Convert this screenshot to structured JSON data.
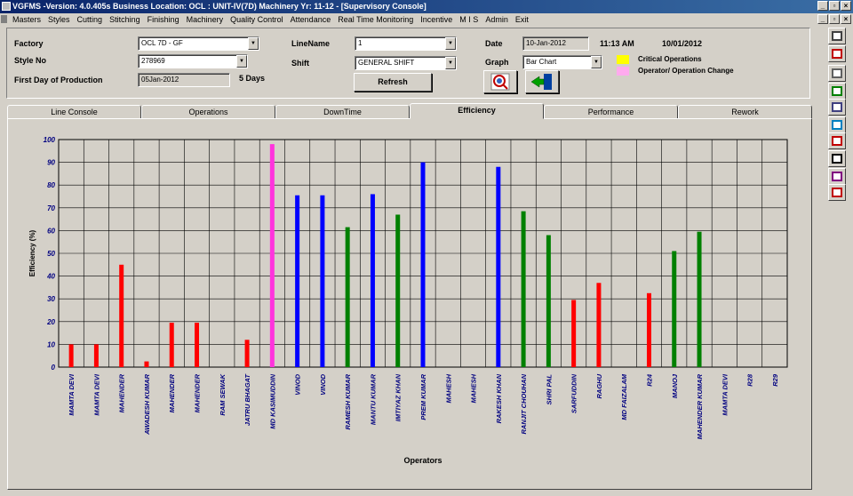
{
  "window": {
    "title": "VGFMS -Version: 4.0.405s Business Location: OCL : UNIT-IV(7D)  Machinery Yr: 11-12  - [Supervisory Console]"
  },
  "menu": [
    "Masters",
    "Styles",
    "Cutting",
    "Stitching",
    "Finishing",
    "Machinery",
    "Quality Control",
    "Attendance",
    "Real Time Monitoring",
    "Incentive",
    "M I S",
    "Admin",
    "Exit"
  ],
  "form": {
    "factory_label": "Factory",
    "factory_value": "OCL 7D - GF",
    "style_label": "Style No",
    "style_value": "278969",
    "first_day_label": "First Day of Production",
    "first_day_value": "05Jan-2012",
    "days_text": "5 Days",
    "line_label": "LineName",
    "line_value": "1",
    "shift_label": "Shift",
    "shift_value": "GENERAL SHIFT",
    "refresh_label": "Refresh",
    "date_label": "Date",
    "date_value": "10-Jan-2012",
    "time_text": "11:13 AM",
    "date_text": "10/01/2012",
    "graph_label": "Graph",
    "graph_value": "Bar Chart",
    "legend_critical": "Critical Operations",
    "legend_change": "Operator/ Operation Change",
    "critical_color": "#ffff00",
    "change_color": "#ffaaee"
  },
  "tabs": [
    "Line Console",
    "Operations",
    "DownTime",
    "Efficiency",
    "Performance",
    "Rework"
  ],
  "active_tab": "Efficiency",
  "toolbar_icons": [
    "print-icon",
    "print-preview-icon",
    "export-icon",
    "word-icon",
    "document-icon",
    "notes-icon",
    "pdf-icon",
    "grid-icon",
    "settings-icon",
    "close-report-icon"
  ],
  "chart_data": {
    "type": "bar",
    "title": "",
    "xlabel": "Operators",
    "ylabel": "Efficiency (%)",
    "ylim": [
      0,
      100
    ],
    "yticks": [
      0,
      10,
      20,
      30,
      40,
      50,
      60,
      70,
      80,
      90,
      100
    ],
    "grid": true,
    "categories": [
      "MAMTA DEVI",
      "MAMTA DEVI",
      "MAHENDER",
      "AWADESH KUMAR",
      "MAHENDER",
      "MAHENDER",
      "RAM SEWAK",
      "JATRU BHAGAT",
      "MD KASIMUDDIN",
      "VINOD",
      "VINOD",
      "RAMESH KUMAR",
      "MANTU KUMAR",
      "IMTIYAZ KHAN",
      "PREM KUMAR",
      "MAHESH",
      "MAHESH",
      "RAKESH KHAN",
      "RANJIT CHOUHAN",
      "SHRI PAL",
      "SARFUDDIN",
      "RAGHU",
      "MD FAIZALAM",
      "R24",
      "MANOJ",
      "MAHENDER KUMAR",
      "MAMTA DEVI",
      "R28",
      "R29"
    ],
    "values": [
      10,
      10,
      45,
      2.5,
      19.5,
      19.5,
      0,
      12,
      98,
      75.5,
      75.5,
      61.5,
      76,
      67,
      90,
      0,
      0,
      88,
      68.5,
      58,
      29.5,
      37,
      0,
      32.5,
      51,
      59.5,
      0,
      0,
      0
    ],
    "colors": [
      "#ff0000",
      "#ff0000",
      "#ff0000",
      "#ff0000",
      "#ff0000",
      "#ff0000",
      "#ff0000",
      "#ff0000",
      "#ff33dd",
      "#0000ff",
      "#0000ff",
      "#008000",
      "#0000ff",
      "#008000",
      "#0000ff",
      "#0000ff",
      "#0000ff",
      "#0000ff",
      "#008000",
      "#008000",
      "#ff0000",
      "#ff0000",
      "#ff0000",
      "#ff0000",
      "#008000",
      "#008000",
      "#008000",
      "#008000",
      "#008000"
    ],
    "label_color": "#000080"
  }
}
